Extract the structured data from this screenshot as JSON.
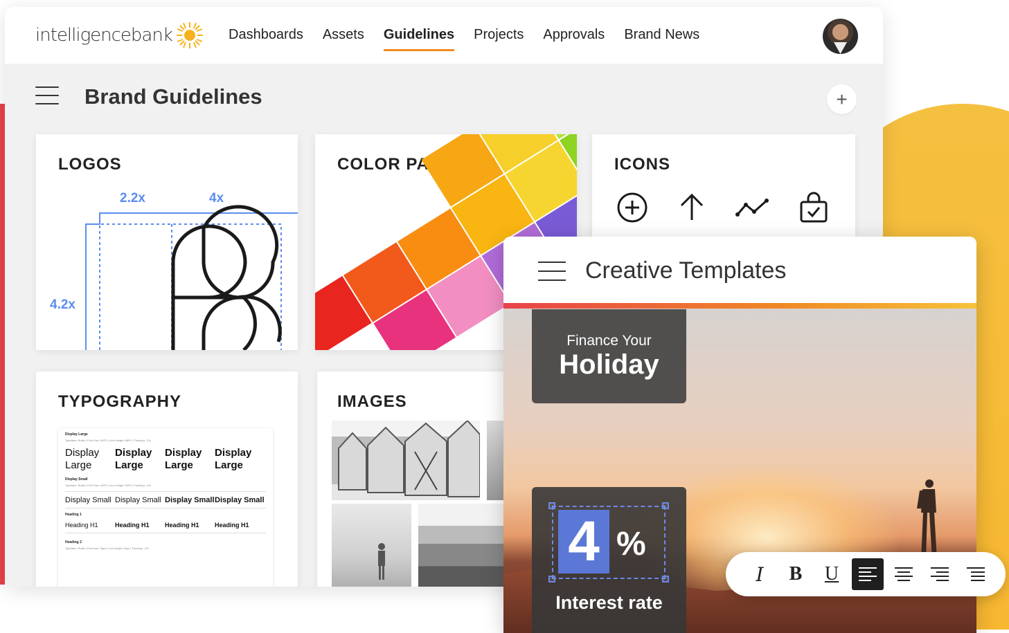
{
  "brand": {
    "logo_text": "intelligencebank",
    "accent_color": "#f08a24",
    "blue_color": "#5b8def"
  },
  "nav": {
    "items": [
      "Dashboards",
      "Assets",
      "Guidelines",
      "Projects",
      "Approvals",
      "Brand News"
    ],
    "active": "Guidelines"
  },
  "page": {
    "title": "Brand Guidelines"
  },
  "cards": {
    "logos": {
      "title": "LOGOS",
      "dim_a": "2.2x",
      "dim_b": "4x",
      "dim_c": "4.2x"
    },
    "colors": {
      "title": "COLOR PALLETTE"
    },
    "icons": {
      "title": "ICONS",
      "icon_names": [
        "plus-circle-icon",
        "arrow-up-icon",
        "trend-line-icon",
        "shopping-bag-check-icon"
      ]
    },
    "typography": {
      "title": "TYPOGRAPHY",
      "display_large_heading": "Display Large",
      "display_large_meta": "Typeface: Rubik | Font Size: 60PX | Line Height: 68PX | Tracking: -2%",
      "display_large_samples": [
        "Display Large",
        "Display Large",
        "Display Large",
        "Display Large"
      ],
      "display_small_heading": "Display Small",
      "display_small_meta": "Typeface: Rubik | Font Size: 40PX | Line Height: 52PX | Tracking: -2%",
      "display_small_samples": [
        "Display Small",
        "Display Small",
        "Display Small",
        "Display Small"
      ],
      "heading1_heading": "Heading 1",
      "heading1_samples": [
        "Heading H1",
        "Heading H1",
        "Heading H1",
        "Heading H1"
      ],
      "heading2_heading": "Heading 2",
      "heading2_meta": "Typeface: Rubik | Font size: 36px | Line height: 44px | Tracking: -2%"
    },
    "images": {
      "title": "IMAGES"
    }
  },
  "creative_templates": {
    "title": "Creative Templates",
    "finance_line1": "Finance Your",
    "finance_line2": "Holiday",
    "rate_number": "4",
    "rate_symbol": "%",
    "rate_label": "Interest rate"
  },
  "toolbar": {
    "buttons": [
      "italic",
      "bold",
      "underline",
      "align-left",
      "align-center",
      "align-right",
      "justify"
    ],
    "active": "align-left",
    "italic_label": "I",
    "bold_label": "B",
    "underline_label": "U"
  }
}
